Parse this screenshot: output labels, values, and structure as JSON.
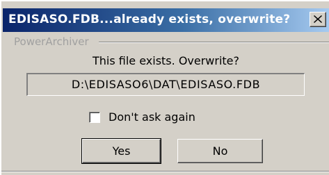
{
  "window": {
    "title": "EDISASO.FDB...already exists, overwrite?",
    "close_icon": "close-icon"
  },
  "group": {
    "label": "PowerArchiver"
  },
  "message": "This file exists.  Overwrite?",
  "file_path": "D:\\EDISASO6\\DAT\\EDISASO.FDB",
  "checkbox": {
    "label": "Don't ask again",
    "checked": false
  },
  "buttons": {
    "yes": "Yes",
    "no": "No"
  },
  "colors": {
    "titlebar_start": "#0a246a",
    "titlebar_end": "#a6caf0",
    "dialog_bg": "#d4d0c8"
  }
}
